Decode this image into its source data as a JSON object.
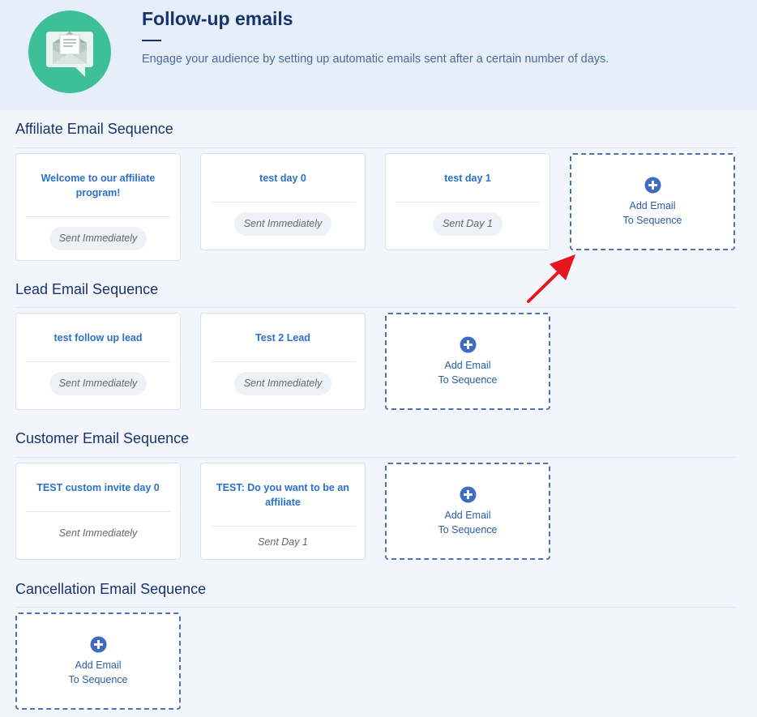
{
  "header": {
    "title": "Follow-up emails",
    "subtitle": "Engage your audience by setting up automatic emails sent after a certain number of days.",
    "logo_icon": "email-chat-icon"
  },
  "add_button": {
    "line1": "Add Email",
    "line2": "To Sequence",
    "icon": "plus-circle-icon"
  },
  "sections": [
    {
      "title": "Affiliate Email Sequence",
      "emails": [
        {
          "title": "Welcome to our affiliate program!",
          "timing": "Sent Immediately"
        },
        {
          "title": "test day 0",
          "timing": "Sent Immediately"
        },
        {
          "title": "test day 1",
          "timing": "Sent Day 1"
        }
      ]
    },
    {
      "title": "Lead Email Sequence",
      "emails": [
        {
          "title": "test follow up lead",
          "timing": "Sent Immediately"
        },
        {
          "title": "Test 2 Lead",
          "timing": "Sent Immediately"
        }
      ]
    },
    {
      "title": "Customer Email Sequence",
      "emails": [
        {
          "title": "TEST custom invite day 0",
          "timing": "Sent Immediately"
        },
        {
          "title": "TEST: Do you want to be an affiliate",
          "timing": "Sent Day 1"
        }
      ]
    },
    {
      "title": "Cancellation Email Sequence",
      "emails": []
    }
  ],
  "colors": {
    "accent": "#2b70c9",
    "brand_green": "#3dbf97",
    "annotation_arrow": "#e8141e"
  }
}
